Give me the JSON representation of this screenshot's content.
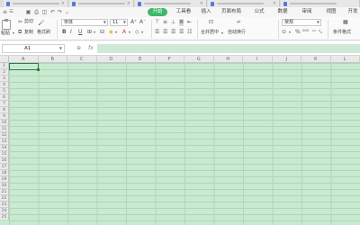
{
  "menubar": {
    "tabs": [
      {
        "label": "开始",
        "active": true
      },
      {
        "label": "工具看"
      },
      {
        "label": "插入"
      },
      {
        "label": "页面布局"
      },
      {
        "label": "公式"
      },
      {
        "label": "数据"
      },
      {
        "label": "审阅"
      },
      {
        "label": "视图"
      },
      {
        "label": "开发"
      }
    ]
  },
  "ribbon": {
    "paste_label": "粘贴",
    "cut_label": "剪切",
    "copy_label": "复制",
    "format_painter_label": "格式刷",
    "font_name": "宋体",
    "font_size": "11",
    "bold": "B",
    "italic": "I",
    "underline": "U",
    "merge_center_label": "合并居中",
    "wrap_text_label": "自动换行",
    "number_format": "常规",
    "table_style_label": "条件格式"
  },
  "formula_bar": {
    "name_box": "A1",
    "fx": "fx",
    "zoom_icon": "zoom-icon",
    "value": ""
  },
  "sheet": {
    "columns": [
      "A",
      "B",
      "C",
      "D",
      "E",
      "F",
      "G",
      "H",
      "I",
      "J",
      "K",
      "L"
    ],
    "rows": [
      "1",
      "2",
      "3",
      "4",
      "5",
      "6",
      "7",
      "8",
      "9",
      "10",
      "11",
      "12",
      "13",
      "14",
      "15",
      "16",
      "17",
      "18",
      "19",
      "20",
      "21",
      "22",
      "23",
      "24",
      "25"
    ],
    "selected_cell": "A1",
    "cell_background": "#c8ebd0",
    "accent": "#3eb86b"
  }
}
